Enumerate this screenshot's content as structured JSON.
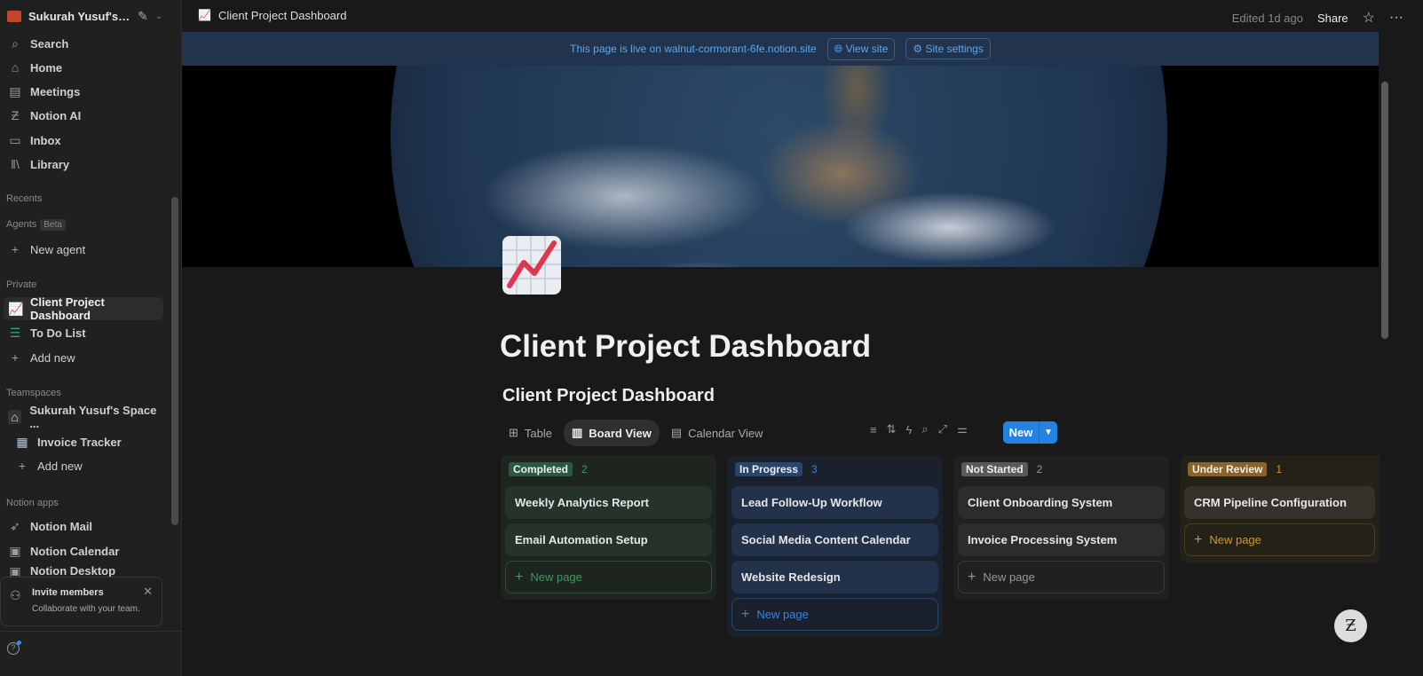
{
  "sidebar": {
    "workspace": "Sukurah Yusuf's S...",
    "nav": [
      {
        "label": "Search",
        "icon": "search-icon"
      },
      {
        "label": "Home",
        "icon": "home-icon"
      },
      {
        "label": "Meetings",
        "icon": "meetings-icon"
      },
      {
        "label": "Notion AI",
        "icon": "notion-ai-icon"
      },
      {
        "label": "Inbox",
        "icon": "inbox-icon"
      },
      {
        "label": "Library",
        "icon": "library-icon"
      }
    ],
    "recents": "Recents",
    "agents": "Agents",
    "beta": "Beta",
    "new_agent": "New agent",
    "private": "Private",
    "private_items": [
      "Client Project Dashboard",
      "To Do List",
      "Add new"
    ],
    "teamspaces": "Teamspaces",
    "team_items": [
      "Sukurah Yusuf's Space ...",
      "Invoice Tracker",
      "Add new"
    ],
    "apps": "Notion apps",
    "app_items": [
      "Notion Mail",
      "Notion Calendar",
      "Notion Desktop"
    ],
    "invite": {
      "title": "Invite members",
      "subtitle": "Collaborate with your team."
    }
  },
  "topbar": {
    "page": "Client Project Dashboard",
    "edited": "Edited 1d ago",
    "share": "Share"
  },
  "banner": {
    "text": "This page is live on walnut-cormorant-6fe.notion.site",
    "view_site": "View site",
    "site_settings": "Site settings"
  },
  "page": {
    "title": "Client Project Dashboard",
    "db_title": "Client Project Dashboard"
  },
  "views": [
    "Table",
    "Board View",
    "Calendar View"
  ],
  "new_button": "New",
  "columns": [
    {
      "name": "Completed",
      "count": "2",
      "cards": [
        "Weekly Analytics Report",
        "Email Automation Setup"
      ],
      "new": "New page",
      "color": "#2b593f"
    },
    {
      "name": "In Progress",
      "count": "3",
      "cards": [
        "Lead Follow-Up Workflow",
        "Social Media Content Calendar",
        "Website Redesign"
      ],
      "new": "New page",
      "color": "#28456c"
    },
    {
      "name": "Not Started",
      "count": "2",
      "cards": [
        "Client Onboarding System",
        "Invoice Processing System"
      ],
      "new": "New page",
      "color": "#5a5a5a"
    },
    {
      "name": "Under Review",
      "count": "1",
      "cards": [
        "CRM Pipeline Configuration"
      ],
      "new": "New page",
      "color": "#89632a"
    }
  ]
}
